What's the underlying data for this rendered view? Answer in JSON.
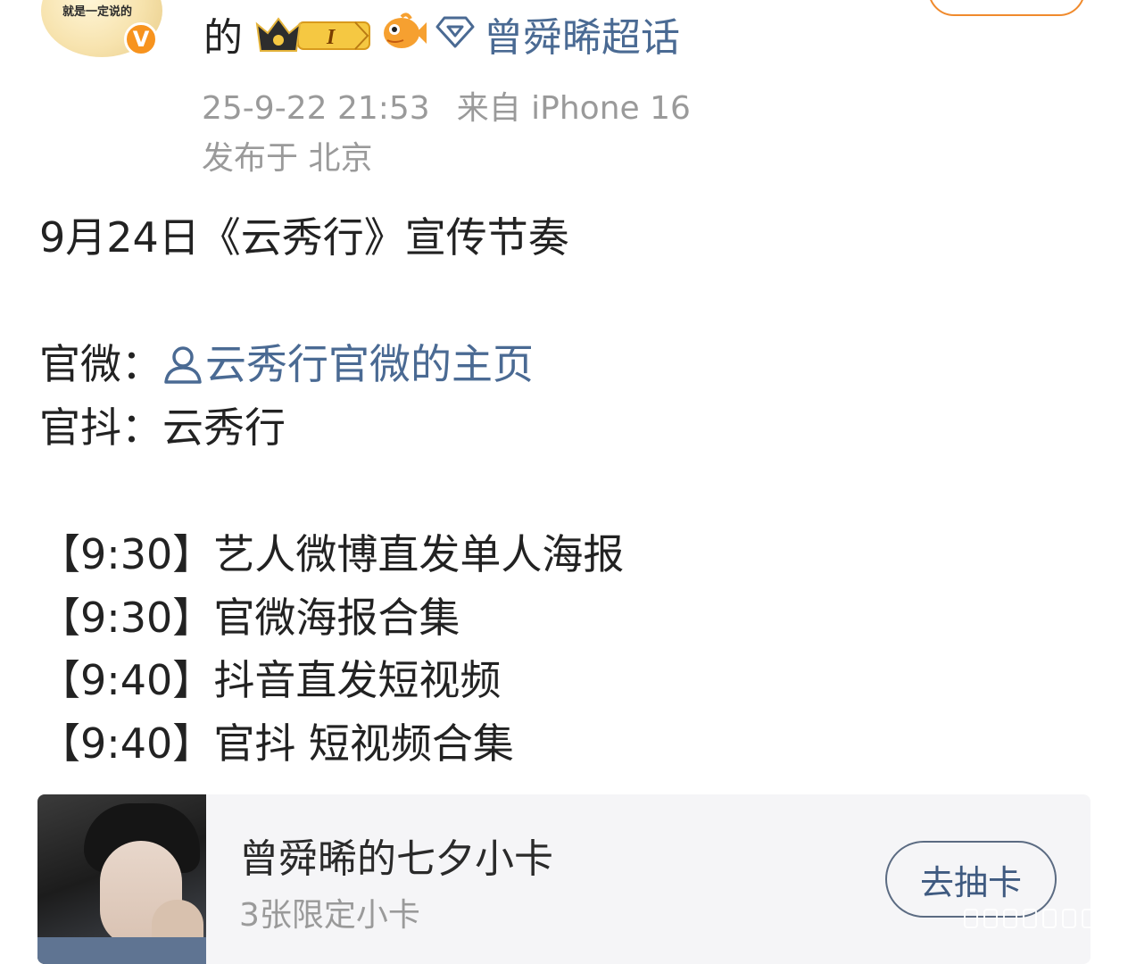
{
  "author": {
    "avatar_text": "就是一定说的",
    "verified_badge": "V",
    "name_tail": "的",
    "level_badge": "I",
    "supertopic_label": "曾舜晞超话",
    "icons": [
      "crown-level-badge-icon",
      "fish-badge-icon",
      "diamond-icon",
      "verified-badge-icon"
    ]
  },
  "meta": {
    "time": "25-9-22 21:53",
    "source": "来自 iPhone 16",
    "location": "发布于 北京"
  },
  "post": {
    "title": "9月24日《云秀行》宣传节奏",
    "wei_label": "官微：",
    "wei_link": "云秀行官微的主页",
    "dou_label": "官抖：",
    "dou_value": "云秀行",
    "schedule": [
      {
        "time": "【9:30】",
        "text": "艺人微博直发单人海报"
      },
      {
        "time": "【9:30】",
        "text": "官微海报合集"
      },
      {
        "time": "【9:40】",
        "text": "抖音直发短视频"
      },
      {
        "time": "【9:40】",
        "text": "官抖 短视频合集"
      }
    ]
  },
  "card": {
    "title": "曾舜晞的七夕小卡",
    "subtitle": "3张限定小卡",
    "button": "去抽卡"
  },
  "colors": {
    "link": "#4a6a93",
    "meta": "#9a9a9a",
    "accent_orange": "#f7931e",
    "card_bg": "#f5f5f7"
  }
}
